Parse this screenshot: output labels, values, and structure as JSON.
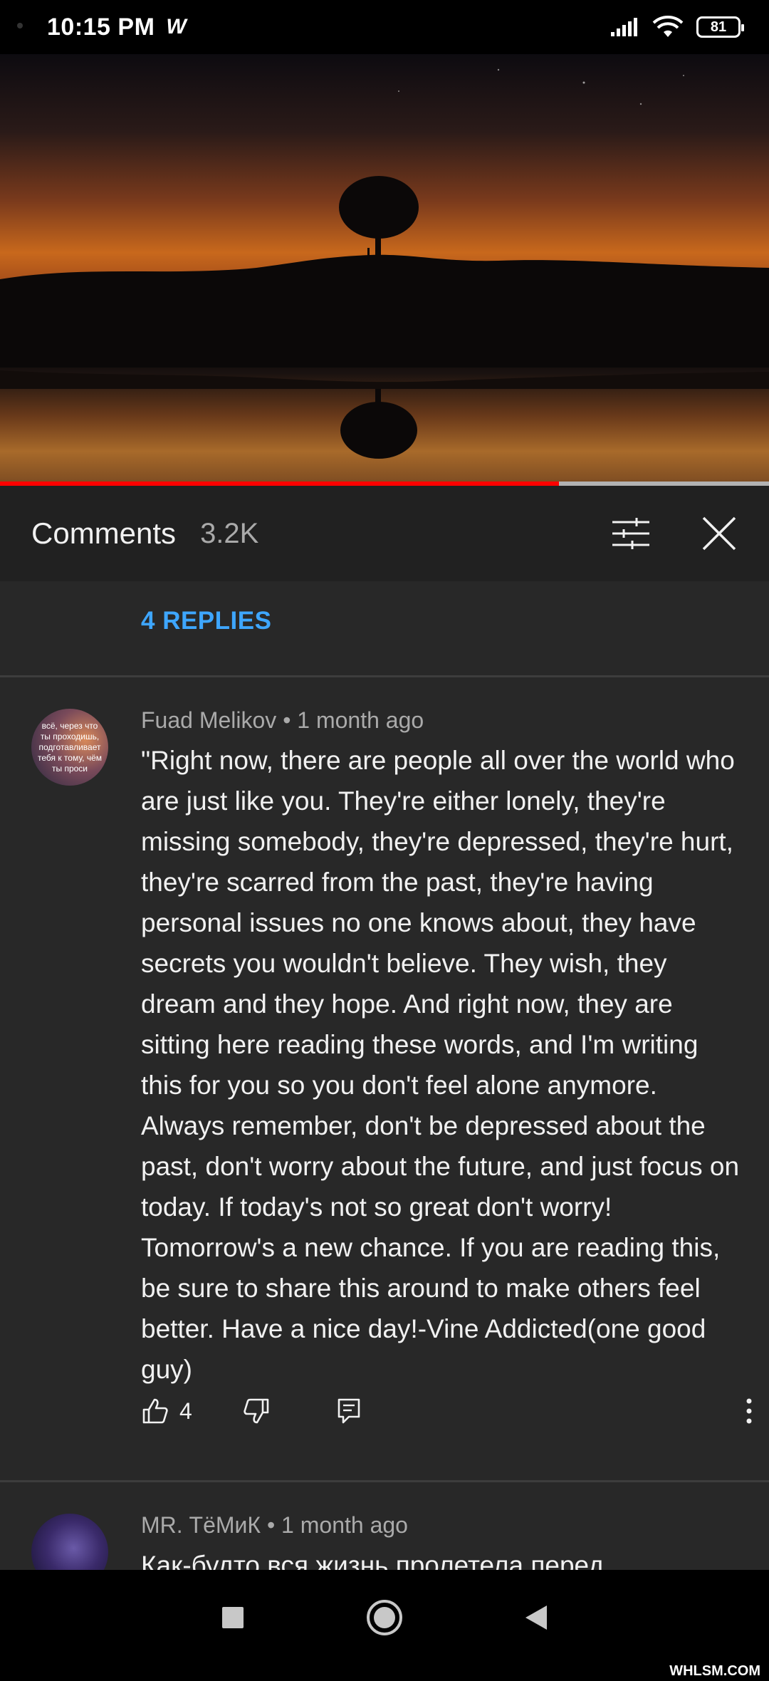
{
  "status_bar": {
    "time": "10:15 PM",
    "app_icon": "W",
    "battery": "81",
    "icons": [
      "signal-icon",
      "wifi-icon",
      "battery-icon"
    ]
  },
  "video": {
    "progress": 0.727,
    "colors": {
      "played": "#ff0000",
      "buffered": "#b3b3b3"
    }
  },
  "comments_header": {
    "title": "Comments",
    "count": "3.2K",
    "icons": [
      "filter-sliders-icon",
      "close-icon"
    ]
  },
  "replies_link": "4 REPLIES",
  "comments": [
    {
      "avatar_text": "всё, через что ты проходишь, подготавливает тебя к тому, чём ты проси",
      "author": "Fuad Melikov",
      "separator": "•",
      "time": "1 month ago",
      "text": "\"Right now, there are people all over the world who are just like you. They're either lonely, they're missing somebody, they're depressed, they're hurt, they're scarred from the past, they're having personal issues no one knows about, they have secrets you wouldn't believe. They wish, they dream and they hope. And right now, they are sitting here reading these words, and I'm writing this for you so you don't feel alone anymore. Always remember, don't be depressed about the past, don't worry about the future, and just focus on today. If today's not so great don't worry! Tomorrow's a new chance. If you are reading this, be sure to share this around to make others feel better. Have a nice day!-Vine Addicted(one good guy)",
      "likes": "4",
      "action_icons": [
        "like-icon",
        "dislike-icon",
        "reply-icon",
        "more-vert-icon"
      ]
    },
    {
      "author": "MR. ТёМиК",
      "separator": "•",
      "time": "1 month ago",
      "text": "Как-будто вся жизнь пролетела перед"
    }
  ],
  "nav_bar": {
    "icons": [
      "recents-square-icon",
      "home-circle-icon",
      "back-triangle-icon"
    ]
  },
  "watermark": "WHLSM.COM"
}
